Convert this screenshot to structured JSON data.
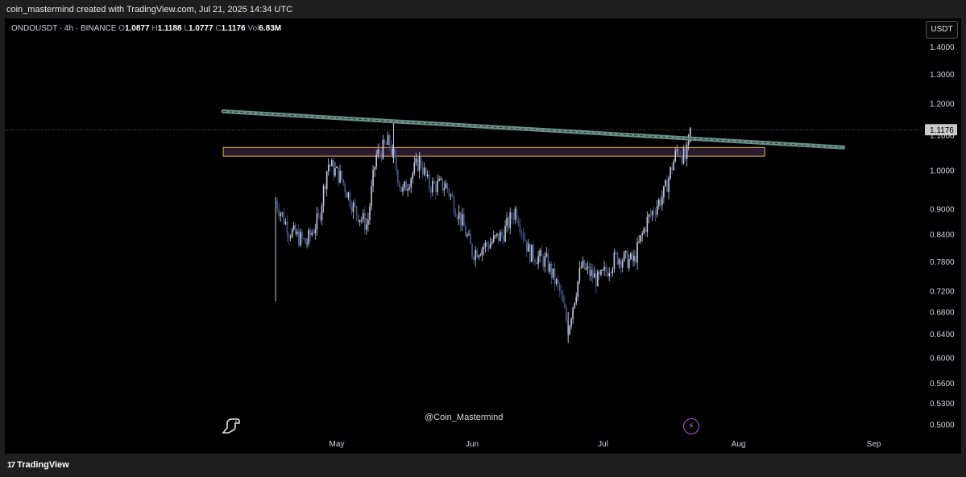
{
  "credit": "coin_mastermind created with TradingView.com, Jul 21, 2025 14:34 UTC",
  "legend": {
    "symbol": "ONDOUSDT · 4h · BINANCE",
    "o_label": "O",
    "o": "1.0877",
    "h_label": "H",
    "h": "1.1188",
    "l_label": "L",
    "l": "1.0777",
    "c_label": "C",
    "c": "1.1176",
    "vol_label": "Vol",
    "vol": "6.83M"
  },
  "currency_button": "USDT",
  "watermark": "@Coin_Mastermind",
  "footer_brand": "TradingView",
  "icons": {
    "dino": "dino-icon",
    "bolt": "lightning-icon",
    "logo": "tradingview-logo-icon"
  },
  "colors": {
    "background": "#000000",
    "candle": "#4a5a8c",
    "candle_light": "#c8cbe0",
    "trendline": "#6a8f86",
    "zone_fill": "#2a1a2e",
    "zone_border": "#e3b04b",
    "price_tag": "#c9c9c9"
  },
  "chart_data": {
    "type": "candlestick",
    "symbol": "ONDOUSDT",
    "interval": "4h",
    "exchange": "BINANCE",
    "price_axis": {
      "scale": "log",
      "ticks": [
        "1.4000",
        "1.3000",
        "1.2000",
        "1.1000",
        "1.0000",
        "0.9000",
        "0.8400",
        "0.7800",
        "0.7200",
        "0.6800",
        "0.6400",
        "0.6000",
        "0.5600",
        "0.5300",
        "0.5000"
      ],
      "last_price_tag": "1.1176"
    },
    "time_axis": {
      "ticks": [
        "May",
        "Jun",
        "Jul",
        "Aug",
        "Sep"
      ]
    },
    "price_path": [
      [
        "2025-04-17",
        0.92
      ],
      [
        "2025-04-20",
        0.85
      ],
      [
        "2025-04-24",
        0.82
      ],
      [
        "2025-04-27",
        0.88
      ],
      [
        "2025-04-29",
        1.02
      ],
      [
        "2025-05-02",
        0.98
      ],
      [
        "2025-05-05",
        0.9
      ],
      [
        "2025-05-08",
        0.86
      ],
      [
        "2025-05-10",
        1.04
      ],
      [
        "2025-05-13",
        1.08
      ],
      [
        "2025-05-16",
        0.94
      ],
      [
        "2025-05-20",
        1.03
      ],
      [
        "2025-05-22",
        0.96
      ],
      [
        "2025-05-26",
        0.96
      ],
      [
        "2025-05-30",
        0.86
      ],
      [
        "2025-06-01",
        0.8
      ],
      [
        "2025-06-05",
        0.82
      ],
      [
        "2025-06-08",
        0.84
      ],
      [
        "2025-06-11",
        0.9
      ],
      [
        "2025-06-14",
        0.8
      ],
      [
        "2025-06-18",
        0.78
      ],
      [
        "2025-06-21",
        0.72
      ],
      [
        "2025-06-23",
        0.65
      ],
      [
        "2025-06-26",
        0.77
      ],
      [
        "2025-06-30",
        0.74
      ],
      [
        "2025-07-04",
        0.79
      ],
      [
        "2025-07-08",
        0.78
      ],
      [
        "2025-07-11",
        0.87
      ],
      [
        "2025-07-15",
        0.94
      ],
      [
        "2025-07-18",
        1.06
      ],
      [
        "2025-07-20",
        1.03
      ],
      [
        "2025-07-21",
        1.1176
      ]
    ],
    "annotations": [
      {
        "type": "descending_trendline",
        "from": [
          "2025-04-05",
          1.175
        ],
        "to": [
          "2025-08-25",
          1.065
        ]
      },
      {
        "type": "resistance_zone",
        "from_date": "2025-04-05",
        "to_date": "2025-08-07",
        "low": 1.04,
        "high": 1.065
      }
    ]
  }
}
